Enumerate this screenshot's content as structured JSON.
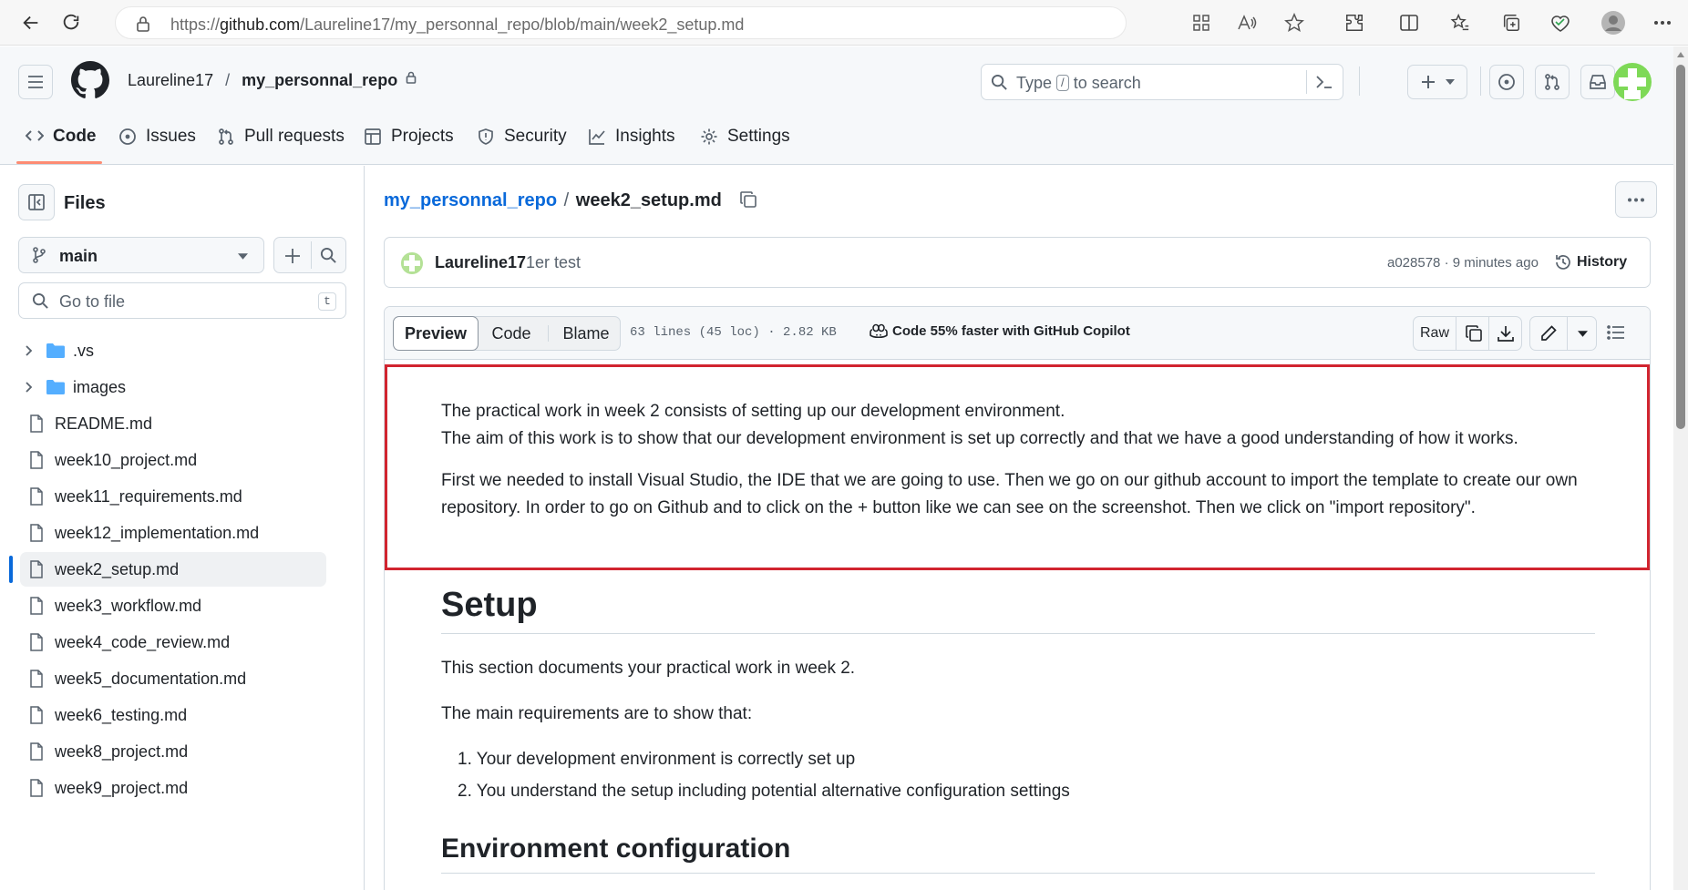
{
  "browser": {
    "url_prefix": "https://",
    "url_host": "github.com",
    "url_path": "/Laureline17/my_personnal_repo/blob/main/week2_setup.md"
  },
  "header": {
    "owner": "Laureline17",
    "separator": "/",
    "repo": "my_personnal_repo",
    "search_prefix": "Type",
    "search_key": "/",
    "search_suffix": "to search"
  },
  "nav": {
    "tabs": [
      {
        "label": "Code",
        "icon": "code-icon",
        "active": true
      },
      {
        "label": "Issues",
        "icon": "issue-icon"
      },
      {
        "label": "Pull requests",
        "icon": "pull-request-icon"
      },
      {
        "label": "Projects",
        "icon": "table-icon"
      },
      {
        "label": "Security",
        "icon": "shield-icon"
      },
      {
        "label": "Insights",
        "icon": "graph-icon"
      },
      {
        "label": "Settings",
        "icon": "gear-icon"
      }
    ]
  },
  "sidebar": {
    "title": "Files",
    "branch": "main",
    "goto_placeholder": "Go to file",
    "goto_shortcut": "t",
    "items": [
      {
        "label": ".vs",
        "type": "folder"
      },
      {
        "label": "images",
        "type": "folder"
      },
      {
        "label": "README.md",
        "type": "file"
      },
      {
        "label": "week10_project.md",
        "type": "file"
      },
      {
        "label": "week11_requirements.md",
        "type": "file"
      },
      {
        "label": "week12_implementation.md",
        "type": "file"
      },
      {
        "label": "week2_setup.md",
        "type": "file",
        "active": true
      },
      {
        "label": "week3_workflow.md",
        "type": "file"
      },
      {
        "label": "week4_code_review.md",
        "type": "file"
      },
      {
        "label": "week5_documentation.md",
        "type": "file"
      },
      {
        "label": "week6_testing.md",
        "type": "file"
      },
      {
        "label": "week8_project.md",
        "type": "file"
      },
      {
        "label": "week9_project.md",
        "type": "file"
      }
    ]
  },
  "file": {
    "repo_link": "my_personnal_repo",
    "separator": "/",
    "name": "week2_setup.md",
    "commit_author": "Laureline17",
    "commit_message": "1er test",
    "commit_meta": "a028578 · 9 minutes ago",
    "history_label": "History"
  },
  "toolbar": {
    "preview": "Preview",
    "code": "Code",
    "blame": "Blame",
    "meta": "63 lines (45 loc) · 2.82 KB",
    "copilot": "Code 55% faster with GitHub Copilot",
    "raw": "Raw"
  },
  "content": {
    "intro_line1": "The practical work in week 2 consists of setting up our development environment.",
    "intro_line2": "The aim of this work is to show that our development environment is set up correctly and that we have a good understanding of how it works.",
    "intro_para2": "First we needed to install Visual Studio, the IDE that we are going to use. Then we go on our github account to import the template to create our own repository. In order to go on Github and to click on the + button like we can see on the screenshot. Then we click on \"import repository\".",
    "h1": "Setup",
    "p1": "This section documents your practical work in week 2.",
    "p2": "The main requirements are to show that:",
    "list": [
      "Your development environment is correctly set up",
      "You understand the setup including potential alternative configuration settings"
    ],
    "h2": "Environment configuration"
  },
  "colors": {
    "accent_link": "#0969da",
    "highlight_border": "#d1242f",
    "active_tab_underline": "#fd8c73",
    "folder": "#54aeff",
    "avatar": "#7ed957"
  }
}
